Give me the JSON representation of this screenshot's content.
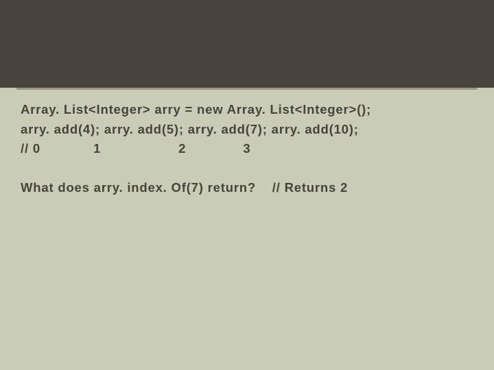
{
  "slide": {
    "lines": {
      "l1": "Array. List<Integer> arry = new Array. List<Integer>();",
      "l2": "arry. add(4); arry. add(5); arry. add(7); arry. add(10);",
      "l3": "// 0             1                   2              3",
      "l4": "What does arry. index. Of(7) return?    // Returns 2"
    }
  }
}
